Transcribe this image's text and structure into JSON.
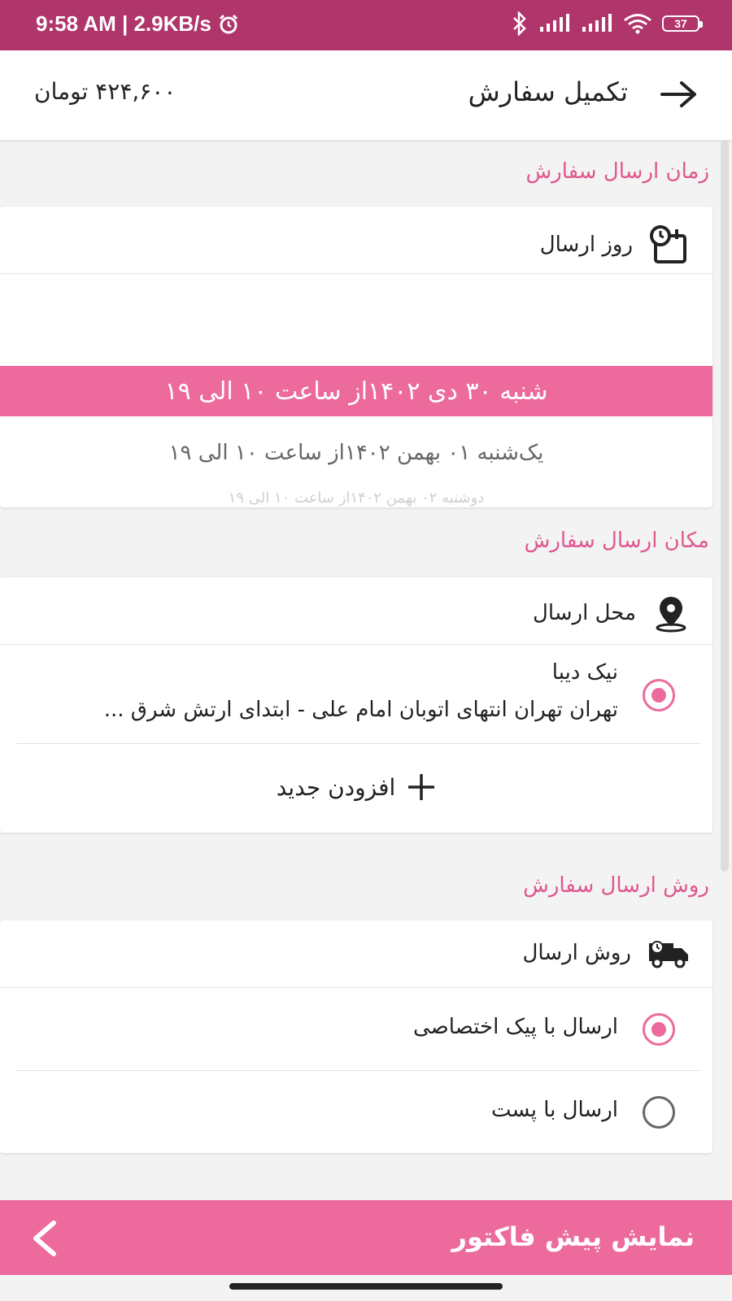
{
  "status_bar": {
    "time_speed": "9:58 AM | 2.9KB/s",
    "battery": "37"
  },
  "app_bar": {
    "title": "تکمیل سفارش",
    "total": "۴۲۴,۶۰۰ تومان"
  },
  "delivery_time": {
    "section_title": "زمان ارسال سفارش",
    "card_label": "روز ارسال",
    "selected_date": "شنبه ۳۰ دی ۱۴۰۲از ساعت ۱۰ الی ۱۹",
    "other_dates": [
      "یک‌شنبه ۰۱ بهمن ۱۴۰۲از ساعت ۱۰ الی ۱۹",
      "دوشنبه ۰۲ بهمن ۱۴۰۲از ساعت ۱۰ الی ۱۹"
    ]
  },
  "delivery_location": {
    "section_title": "مکان ارسال سفارش",
    "card_label": "محل ارسال",
    "address_name": "نیک دیبا",
    "address_line": "تهران تهران انتهای اتوبان امام علی - ابتدای ارتش شرق ...",
    "add_new_label": "افزودن جدید"
  },
  "delivery_method": {
    "section_title": "روش ارسال سفارش",
    "card_label": "روش ارسال",
    "options": [
      {
        "label": "ارسال با پیک اختصاصی",
        "selected": true
      },
      {
        "label": "ارسال با پست",
        "selected": false
      }
    ]
  },
  "bottom_button": {
    "label": "نمایش پیش فاکتور"
  },
  "colors": {
    "status_bar": "#b0356a",
    "accent": "#ec6a9c",
    "section_title": "#e0578e"
  },
  "icons": {
    "back": "arrow-right-icon",
    "calendar": "calendar-clock-icon",
    "location": "location-pin-icon",
    "truck": "delivery-truck-icon",
    "add": "plus-icon",
    "chevron": "chevron-left-icon"
  }
}
